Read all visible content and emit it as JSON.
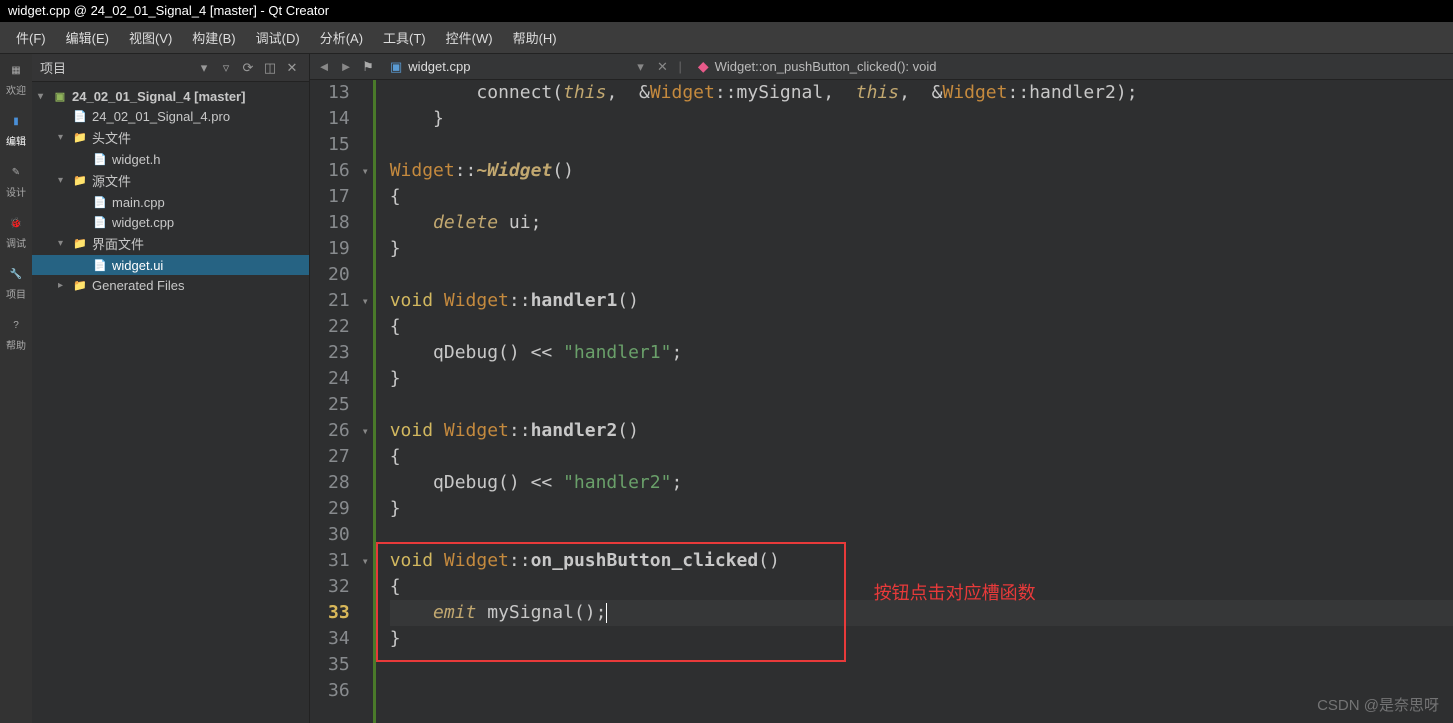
{
  "window": {
    "title": "widget.cpp @ 24_02_01_Signal_4 [master] - Qt Creator"
  },
  "menu": {
    "file": "件(F)",
    "edit": "编辑(E)",
    "view": "视图(V)",
    "build": "构建(B)",
    "debug": "调试(D)",
    "analyze": "分析(A)",
    "tools": "工具(T)",
    "widgets": "控件(W)",
    "help": "帮助(H)"
  },
  "leftbar": {
    "welcome": "欢迎",
    "edit": "编辑",
    "design": "设计",
    "debug": "调试",
    "projects": "项目",
    "help": "帮助"
  },
  "panel": {
    "title": "项目"
  },
  "tree": {
    "project": "24_02_01_Signal_4 [master]",
    "pro": "24_02_01_Signal_4.pro",
    "headers": "头文件",
    "widget_h": "widget.h",
    "sources": "源文件",
    "main_cpp": "main.cpp",
    "widget_cpp": "widget.cpp",
    "forms": "界面文件",
    "widget_ui": "widget.ui",
    "generated": "Generated Files"
  },
  "tabs": {
    "file": "widget.cpp",
    "crumb": "Widget::on_pushButton_clicked(): void"
  },
  "code": {
    "l13": {
      "fn": "connect",
      "a1": "this",
      "c1": ",  &",
      "cls": "Widget",
      "m1": "::mySignal,  ",
      "a2": "this",
      "c2": ",  &",
      "cls2": "Widget",
      "m2": "::handler2);"
    },
    "l14": "    }",
    "l16": {
      "cls": "Widget",
      "op": "::",
      "dtor": "~Widget",
      "paren": "()"
    },
    "l17": "{",
    "l18": {
      "kw": "delete",
      "rest": " ui;"
    },
    "l19": "}",
    "l21": {
      "ret": "void ",
      "cls": "Widget",
      "op": "::",
      "fn": "handler1",
      "paren": "()"
    },
    "l22": "{",
    "l23": {
      "pre": "    qDebug() << ",
      "str": "\"handler1\"",
      "post": ";"
    },
    "l24": "}",
    "l26": {
      "ret": "void ",
      "cls": "Widget",
      "op": "::",
      "fn": "handler2",
      "paren": "()"
    },
    "l27": "{",
    "l28": {
      "pre": "    qDebug() << ",
      "str": "\"handler2\"",
      "post": ";"
    },
    "l29": "}",
    "l31": {
      "ret": "void ",
      "cls": "Widget",
      "op": "::",
      "fn": "on_pushButton_clicked",
      "paren": "()"
    },
    "l32": "{",
    "l33": {
      "kw": "emit",
      "rest": " mySignal();"
    },
    "l34": "}"
  },
  "lines": [
    "13",
    "14",
    "15",
    "16",
    "17",
    "18",
    "19",
    "20",
    "21",
    "22",
    "23",
    "24",
    "25",
    "26",
    "27",
    "28",
    "29",
    "30",
    "31",
    "32",
    "33",
    "34",
    "35",
    "36"
  ],
  "annotation": "按钮点击对应槽函数",
  "watermark": "CSDN @是奈思呀"
}
